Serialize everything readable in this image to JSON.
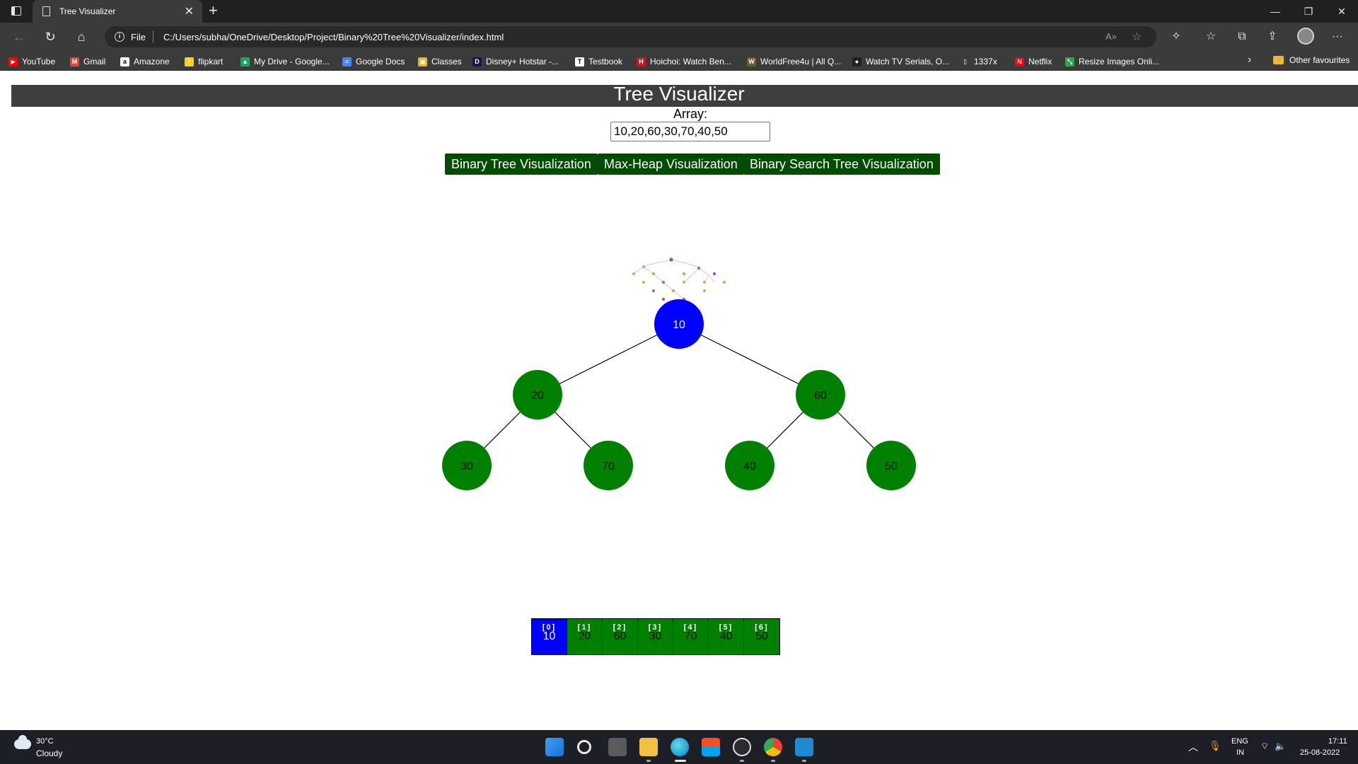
{
  "browser": {
    "tab_title": "Tree Visualizer",
    "tab_close": "✕",
    "new_tab": "+",
    "url_scheme": "File",
    "url": "C:/Users/subha/OneDrive/Desktop/Project/Binary%20Tree%20Visualizer/index.html",
    "window_controls": {
      "minimize": "—",
      "restore": "❐",
      "close": "✕"
    },
    "nav": {
      "back": "←",
      "refresh": "↻",
      "home": "⌂"
    },
    "toolbar_icons": [
      "read-aloud-icon",
      "favorite-add-icon",
      "extensions-icon",
      "favorites-icon",
      "collections-icon",
      "share-icon",
      "profile-icon",
      "more-icon"
    ],
    "more": "···"
  },
  "bookmarks": [
    {
      "label": "YouTube",
      "icon": "youtube-icon",
      "color": "#ff0000",
      "glyph": "▶"
    },
    {
      "label": "Gmail",
      "icon": "gmail-icon",
      "color": "#ea4335",
      "glyph": "M"
    },
    {
      "label": "Amazone",
      "icon": "amazon-icon",
      "color": "#ffffff",
      "glyph": "a"
    },
    {
      "label": "flipkart",
      "icon": "flipkart-icon",
      "color": "#f7d117",
      "glyph": "f"
    },
    {
      "label": "My Drive - Google...",
      "icon": "drive-icon",
      "color": "#1fa463",
      "glyph": "▲"
    },
    {
      "label": "Google Docs",
      "icon": "docs-icon",
      "color": "#4285f4",
      "glyph": "≡"
    },
    {
      "label": "Classes",
      "icon": "classroom-icon",
      "color": "#f4b400",
      "glyph": "▣"
    },
    {
      "label": "Disney+ Hotstar -...",
      "icon": "hotstar-icon",
      "color": "#0f1a4a",
      "glyph": "D"
    },
    {
      "label": "Testbook",
      "icon": "testbook-icon",
      "color": "#ffffff",
      "glyph": "T"
    },
    {
      "label": "Hoichoi: Watch Ben...",
      "icon": "hoichoi-icon",
      "color": "#d6111b",
      "glyph": "H"
    },
    {
      "label": "WorldFree4u | All Q...",
      "icon": "worldfree-icon",
      "color": "#6b5a2e",
      "glyph": "W"
    },
    {
      "label": "Watch TV Serials, O...",
      "icon": "tv-icon",
      "color": "#222222",
      "glyph": "●"
    },
    {
      "label": "1337x",
      "icon": "page-icon",
      "color": "#3b3b3b",
      "glyph": "▯"
    },
    {
      "label": "Netflix",
      "icon": "netflix-icon",
      "color": "#e50914",
      "glyph": "N"
    },
    {
      "label": "Resize Images Onli...",
      "icon": "resize-icon",
      "color": "#2ea44f",
      "glyph": "⤡"
    }
  ],
  "bookmarks_more": "›",
  "other_favourites": "Other favourites",
  "app": {
    "title": "Tree Visualizer",
    "array_label": "Array:",
    "array_value": "10,20,60,30,70,40,50",
    "buttons": {
      "binary_tree": "Binary Tree Visualization",
      "max_heap": "Max-Heap Visualization",
      "bst": "Binary Search Tree Visualization"
    },
    "colors": {
      "root": "#0000ff",
      "node": "#008000",
      "button": "#004d00",
      "banner": "#3e3e3e"
    },
    "tree_nodes": [
      {
        "value": "10",
        "color": "#0000ff"
      },
      {
        "value": "20",
        "color": "#008000"
      },
      {
        "value": "60",
        "color": "#008000"
      },
      {
        "value": "30",
        "color": "#008000"
      },
      {
        "value": "70",
        "color": "#008000"
      },
      {
        "value": "40",
        "color": "#008000"
      },
      {
        "value": "50",
        "color": "#008000"
      }
    ],
    "array_cells": [
      {
        "index": "[0]",
        "value": "10"
      },
      {
        "index": "[1]",
        "value": "20"
      },
      {
        "index": "[2]",
        "value": "60"
      },
      {
        "index": "[3]",
        "value": "30"
      },
      {
        "index": "[4]",
        "value": "70"
      },
      {
        "index": "[5]",
        "value": "40"
      },
      {
        "index": "[6]",
        "value": "50"
      }
    ]
  },
  "taskbar": {
    "weather_temp": "30°C",
    "weather_desc": "Cloudy",
    "apps": [
      "windows-start-icon",
      "search-icon",
      "task-view-icon",
      "file-explorer-icon",
      "edge-icon",
      "store-icon",
      "obs-icon",
      "chrome-icon",
      "vscode-icon"
    ],
    "lang": "ENG",
    "region": "IN",
    "time": "17:11",
    "date": "25-08-2022"
  }
}
